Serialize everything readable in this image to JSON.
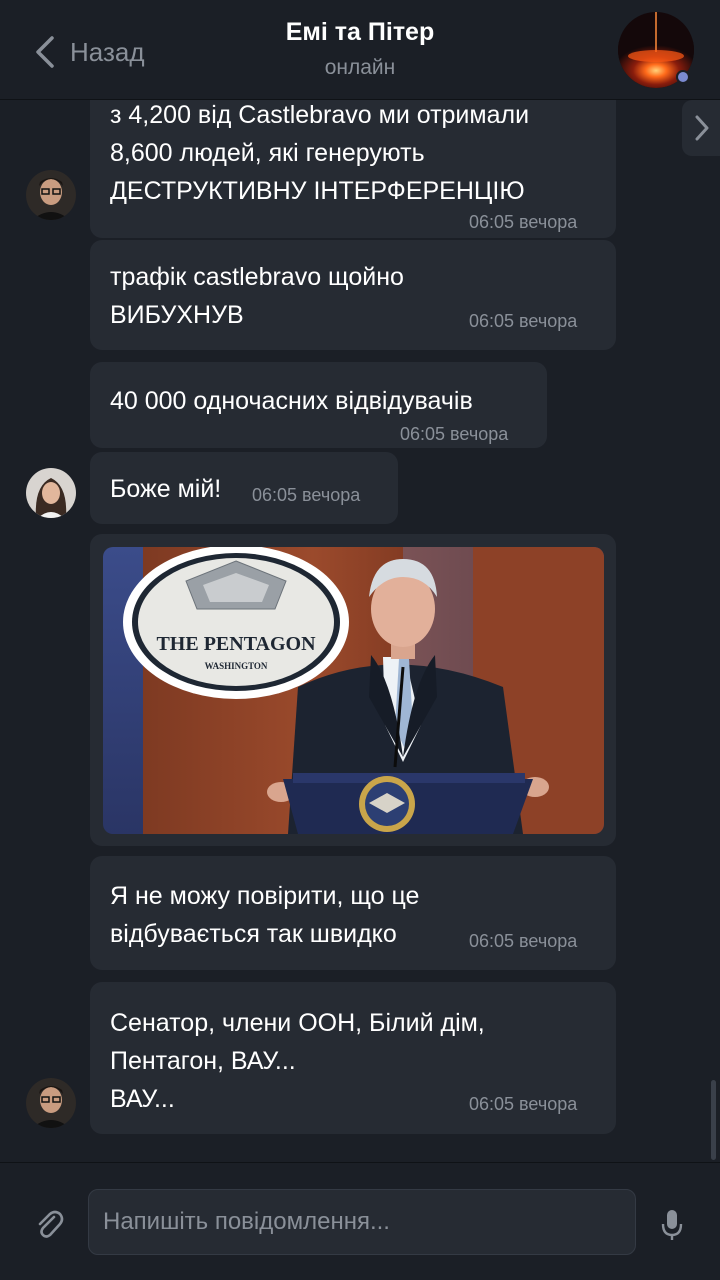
{
  "header": {
    "back_label": "Назад",
    "title": "Емі та Пітер",
    "status": "онлайн"
  },
  "messages": [
    {
      "text": "з 4,200 від Castlebravo ми отримали\n8,600 людей, які генерують\nДЕСТРУКТИВНУ ІНТЕРФЕРЕНЦІЮ",
      "time": "06:05 вечора"
    },
    {
      "text": "трафік castlebravo щойно\nВИБУХНУВ",
      "time": "06:05 вечора"
    },
    {
      "text": "40 000 одночасних відвідувачів",
      "time": "06:05 вечора"
    },
    {
      "text": "Боже мій!",
      "time": "06:05 вечора"
    },
    {
      "text": "Я не можу повірити, що це\nвідбувається так швидко",
      "time": "06:05 вечора"
    },
    {
      "text": "Сенатор, члени ООН, Білий дім,\nПентагон, ВАУ...\nВАУ...",
      "time": "06:05 вечора"
    }
  ],
  "photo": {
    "sign_title": "THE PENTAGON",
    "sign_subtitle": "WASHINGTON"
  },
  "composer": {
    "placeholder": "Напишіть повідомлення..."
  },
  "icons": {
    "back": "chevron-left-icon",
    "side": "chevron-right-icon",
    "attach": "paperclip-icon",
    "mic": "microphone-icon"
  },
  "colors": {
    "background": "#1b1f26",
    "bubble": "#262b33",
    "text": "#ffffff",
    "muted": "#8a9099",
    "online": "#7b8ad0"
  }
}
